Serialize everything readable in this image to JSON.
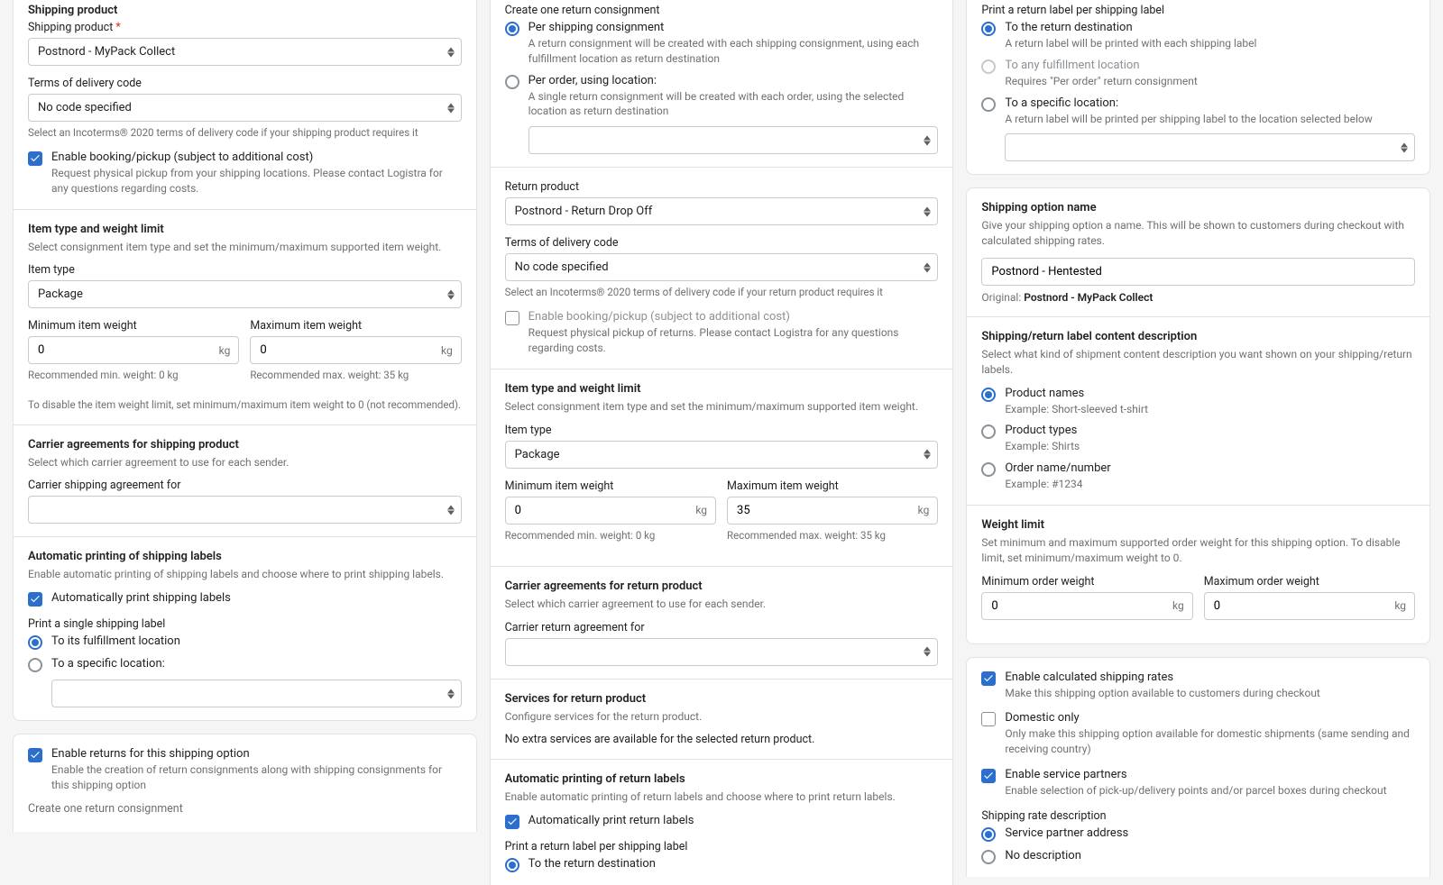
{
  "col1": {
    "ship_prod_title": "Shipping product",
    "ship_prod_label": "Shipping product",
    "ship_prod_value": "Postnord - MyPack Collect",
    "terms_label": "Terms of delivery code",
    "terms_value": "No code specified",
    "terms_help": "Select an Incoterms® 2020 terms of delivery code if your shipping product requires it",
    "booking_label": "Enable booking/pickup (subject to additional cost)",
    "booking_sub": "Request physical pickup from your shipping locations. Please contact Logistra for any questions regarding costs.",
    "itemtype_title": "Item type and weight limit",
    "itemtype_sub": "Select consignment item type and set the minimum/maximum supported item weight.",
    "itemtype_label": "Item type",
    "itemtype_value": "Package",
    "minw_label": "Minimum item weight",
    "minw_value": "0",
    "minw_help": "Recommended min. weight: 0 kg",
    "maxw_label": "Maximum item weight",
    "maxw_value": "0",
    "maxw_help": "Recommended max. weight: 35 kg",
    "weight_disable_help": "To disable the item weight limit, set minimum/maximum item weight to 0 (not recommended).",
    "kg": "kg",
    "carrier_title": "Carrier agreements for shipping product",
    "carrier_sub": "Select which carrier agreement to use for each sender.",
    "carrier_label": "Carrier shipping agreement for",
    "autoprint_title": "Automatic printing of shipping labels",
    "autoprint_sub": "Enable automatic printing of shipping labels and choose where to print shipping labels.",
    "autoprint_check": "Automatically print shipping labels",
    "single_label_label": "Print a single shipping label",
    "single_opt1": "To its fulfillment location",
    "single_opt2": "To a specific location:",
    "returns_check": "Enable returns for this shipping option",
    "returns_sub": "Enable the creation of return consignments along with shipping consignments for this shipping option",
    "create_one_cut": "Create one return consignment"
  },
  "col2": {
    "create_title": "Create one return consignment",
    "create_opt1": "Per shipping consignment",
    "create_opt1_sub": "A return consignment will be created with each shipping consignment, using each fulfillment location as return destination",
    "create_opt2": "Per order, using location:",
    "create_opt2_sub": "A single return consignment will be created with each order, using the selected location as return destination",
    "retprod_label": "Return product",
    "retprod_value": "Postnord - Return Drop Off",
    "terms_label": "Terms of delivery code",
    "terms_value": "No code specified",
    "terms_help": "Select an Incoterms® 2020 terms of delivery code if your return product requires it",
    "booking_label": "Enable booking/pickup (subject to additional cost)",
    "booking_sub": "Request physical pickup of returns. Please contact Logistra for any questions regarding costs.",
    "itemtype_title": "Item type and weight limit",
    "itemtype_sub": "Select consignment item type and set the minimum/maximum supported item weight.",
    "itemtype_label": "Item type",
    "itemtype_value": "Package",
    "minw_label": "Minimum item weight",
    "minw_value": "0",
    "minw_help": "Recommended min. weight: 0 kg",
    "maxw_label": "Maximum item weight",
    "maxw_value": "35",
    "maxw_help": "Recommended max. weight: 35 kg",
    "kg": "kg",
    "carrier_title": "Carrier agreements for return product",
    "carrier_sub": "Select which carrier agreement to use for each sender.",
    "carrier_label": "Carrier return agreement for",
    "services_title": "Services for return product",
    "services_sub": "Configure services for the return product.",
    "services_none": "No extra services are available for the selected return product.",
    "autoprint_title": "Automatic printing of return labels",
    "autoprint_sub": "Enable automatic printing of return labels and choose where to print return labels.",
    "autoprint_check": "Automatically print return labels",
    "perlabel_label": "Print a return label per shipping label",
    "perlabel_opt1": "To the return destination"
  },
  "col3": {
    "perlabel_label_top": "Print a return label per shipping label",
    "perlabel_opt1": "To the return destination",
    "perlabel_opt1_sub": "A return label will be printed with each shipping label",
    "perlabel_opt2": "To any fulfillment location",
    "perlabel_opt2_sub": "Requires \"Per order\" return consignment",
    "perlabel_opt3": "To a specific location:",
    "perlabel_opt3_sub": "A return label will be printed per shipping label to the location selected below",
    "optname_title": "Shipping option name",
    "optname_sub": "Give your shipping option a name. This will be shown to customers during checkout with calculated shipping rates.",
    "optname_value": "Postnord - Hentested",
    "original_prefix": "Original: ",
    "original_value": "Postnord - MyPack Collect",
    "content_title": "Shipping/return label content description",
    "content_sub": "Select what kind of shipment content description you want shown on your shipping/return labels.",
    "content_opt1": "Product names",
    "content_opt1_sub": "Example: Short-sleeved t-shirt",
    "content_opt2": "Product types",
    "content_opt2_sub": "Example: Shirts",
    "content_opt3": "Order name/number",
    "content_opt3_sub": "Example: #1234",
    "wlimit_title": "Weight limit",
    "wlimit_sub": "Set minimum and maximum supported order weight for this shipping option. To disable limit, set minimum/maximum weight to 0.",
    "wmin_label": "Minimum order weight",
    "wmin_value": "0",
    "wmax_label": "Maximum order weight",
    "wmax_value": "0",
    "kg": "kg",
    "calc_label": "Enable calculated shipping rates",
    "calc_sub": "Make this shipping option available to customers during checkout",
    "dom_label": "Domestic only",
    "dom_sub": "Only make this shipping option available for domestic shipments (same sending and receiving country)",
    "svc_label": "Enable service partners",
    "svc_sub": "Enable selection of pick-up/delivery points and/or parcel boxes during checkout",
    "rate_label": "Shipping rate description",
    "rate_opt1": "Service partner address",
    "rate_opt2": "No description"
  }
}
